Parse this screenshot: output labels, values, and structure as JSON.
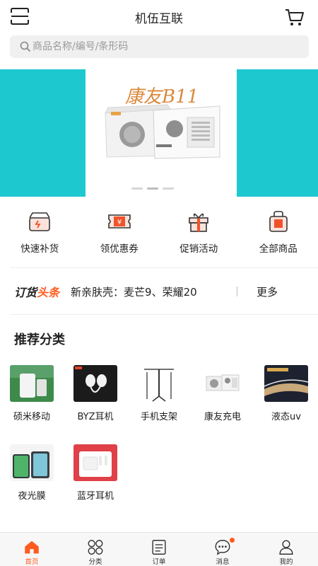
{
  "header": {
    "title": "机伍互联",
    "scan_icon": "scan-icon",
    "cart_icon": "cart-icon"
  },
  "search": {
    "placeholder": "商品名称/编号/条形码",
    "icon": "search-icon"
  },
  "banner": {
    "brand_text": "康友B11",
    "slides": 3,
    "active_slide": 2
  },
  "quick_actions": [
    {
      "label": "快速补货",
      "icon": "box-icon"
    },
    {
      "label": "领优惠券",
      "icon": "coupon-icon"
    },
    {
      "label": "促销活动",
      "icon": "gift-icon"
    },
    {
      "label": "全部商品",
      "icon": "bag-icon"
    }
  ],
  "news": {
    "logo_part1": "订货",
    "logo_part2": "头条",
    "text": "新亲肤壳：麦芒9、荣耀20",
    "more": "更多"
  },
  "section": {
    "title": "推荐分类"
  },
  "categories": [
    {
      "label": "硕米移动"
    },
    {
      "label": "BYZ耳机"
    },
    {
      "label": "手机支架"
    },
    {
      "label": "康友充电"
    },
    {
      "label": "液态uv"
    },
    {
      "label": "夜光膜"
    },
    {
      "label": "蓝牙耳机"
    }
  ],
  "tabs": [
    {
      "label": "首页",
      "icon": "home-icon"
    },
    {
      "label": "分类",
      "icon": "grid-icon"
    },
    {
      "label": "订单",
      "icon": "order-icon"
    },
    {
      "label": "消息",
      "icon": "message-icon"
    },
    {
      "label": "我的",
      "icon": "user-icon"
    }
  ],
  "colors": {
    "accent": "#ff5a1f",
    "banner_bg": "#1ec8cf",
    "icon_orange": "#f0532b"
  }
}
